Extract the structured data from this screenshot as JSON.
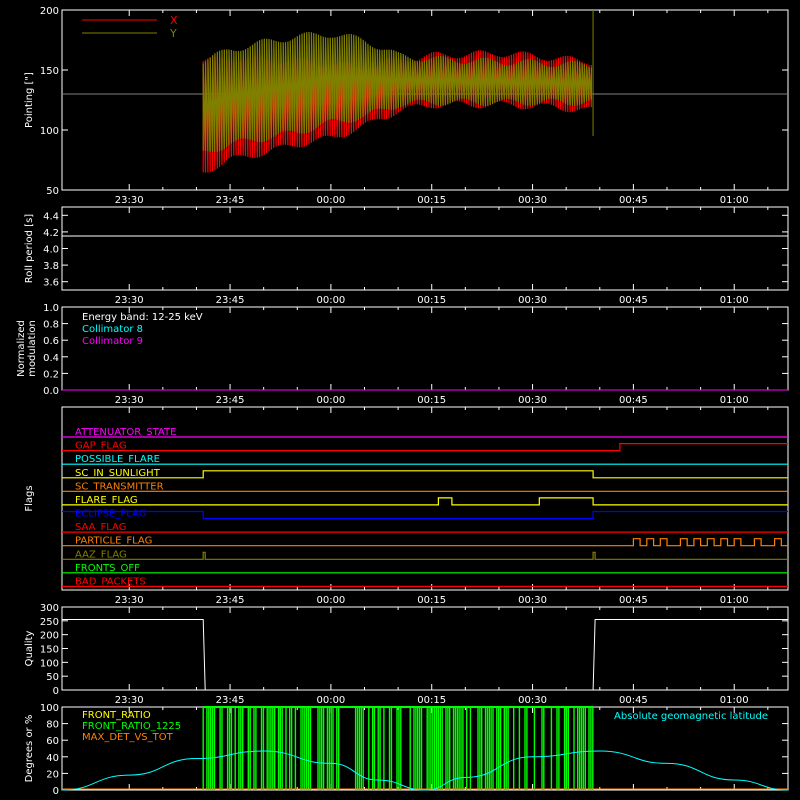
{
  "x_ticks": [
    "23:30",
    "23:45",
    "00:00",
    "00:15",
    "00:30",
    "00:45",
    "01:00"
  ],
  "colors": {
    "background": "#000000",
    "foreground": "#ffffff",
    "red": "#ff0000",
    "olive": "#808000",
    "cyan": "#00ffff",
    "magenta": "#ff00ff",
    "yellow": "#ffff00",
    "green": "#00ff00",
    "blue": "#0000ff",
    "orange": "#ff8000"
  },
  "chart_data": [
    {
      "type": "line",
      "id": "pointing",
      "ylabel": "Pointing [\"]",
      "ylim": [
        50,
        200
      ],
      "yticks": [
        50,
        100,
        150,
        200
      ],
      "legend": [
        {
          "name": "X",
          "color": "#ff0000"
        },
        {
          "name": "Y",
          "color": "#808000"
        }
      ],
      "legend_position": "top-left",
      "reference_line": 130,
      "series": [
        {
          "name": "X",
          "t": [
            "23:41",
            "23:45",
            "23:50",
            "23:55",
            "00:00",
            "00:05",
            "00:10",
            "00:15",
            "00:20",
            "00:25",
            "00:30",
            "00:35",
            "00:39"
          ],
          "low": [
            62,
            72,
            78,
            85,
            90,
            100,
            113,
            118,
            118,
            118,
            117,
            115,
            113
          ],
          "high": [
            160,
            163,
            162,
            160,
            158,
            155,
            161,
            165,
            166,
            167,
            165,
            162,
            160
          ]
        },
        {
          "name": "Y",
          "t": [
            "23:41",
            "23:45",
            "23:50",
            "23:55",
            "00:00",
            "00:05",
            "00:10",
            "00:15",
            "00:20",
            "00:25",
            "00:30",
            "00:35",
            "00:39"
          ],
          "low": [
            78,
            85,
            90,
            95,
            103,
            108,
            118,
            120,
            120,
            120,
            120,
            120,
            120
          ],
          "high": [
            160,
            170,
            176,
            181,
            183,
            178,
            165,
            162,
            161,
            160,
            159,
            158,
            157
          ]
        }
      ]
    },
    {
      "type": "line",
      "id": "roll",
      "ylabel": "Roll period [s]",
      "ylim": [
        3.5,
        4.5
      ],
      "yticks": [
        3.6,
        3.8,
        4.0,
        4.2,
        4.4
      ],
      "series": [
        {
          "name": "",
          "t": [
            "23:20",
            "01:08"
          ],
          "y": [
            4.15,
            4.15
          ]
        }
      ]
    },
    {
      "type": "line",
      "id": "modulation",
      "ylabel": "Normalized modulation",
      "ylim": [
        0,
        1
      ],
      "yticks": [
        0.0,
        0.2,
        0.4,
        0.6,
        0.8,
        1.0
      ],
      "annotation": "Energy band: 12-25 keV",
      "legend": [
        {
          "name": "Collimator 8",
          "color": "#00ffff"
        },
        {
          "name": "Collimator 9",
          "color": "#ff00ff"
        }
      ],
      "series": [
        {
          "name": "Collimator 9",
          "t": [
            "23:20",
            "01:08"
          ],
          "y": [
            0,
            0
          ]
        }
      ]
    },
    {
      "type": "line",
      "id": "flags",
      "ylabel": "Flags",
      "series": [
        {
          "name": "ATTENUATOR_STATE",
          "color": "#ff00ff",
          "steps": [
            [
              "23:20",
              0
            ],
            [
              "01:08",
              0
            ]
          ]
        },
        {
          "name": "GAP_FLAG",
          "color": "#ff0000",
          "steps": [
            [
              "23:20",
              0
            ],
            [
              "00:43",
              1
            ],
            [
              "01:08",
              1
            ]
          ]
        },
        {
          "name": "POSSIBLE_FLARE",
          "color": "#00ffff",
          "steps": [
            [
              "23:20",
              0
            ],
            [
              "01:08",
              0
            ]
          ]
        },
        {
          "name": "SC_IN_SUNLIGHT",
          "color": "#ffff00",
          "steps": [
            [
              "23:20",
              0
            ],
            [
              "23:41",
              1
            ],
            [
              "00:39",
              0
            ],
            [
              "01:08",
              0
            ]
          ]
        },
        {
          "name": "SC_TRANSMITTER",
          "color": "#ff8000",
          "steps": [
            [
              "23:20",
              0
            ],
            [
              "01:08",
              0
            ]
          ]
        },
        {
          "name": "FLARE_FLAG",
          "color": "#ffff00",
          "steps": [
            [
              "23:20",
              0
            ],
            [
              "00:16",
              1
            ],
            [
              "00:18",
              0
            ],
            [
              "00:31",
              1
            ],
            [
              "00:39",
              0
            ],
            [
              "01:08",
              0
            ]
          ]
        },
        {
          "name": "ECLIPSE_FLAG",
          "color": "#0000ff",
          "steps": [
            [
              "23:20",
              1
            ],
            [
              "23:41",
              0
            ],
            [
              "00:39",
              1
            ],
            [
              "01:08",
              1
            ]
          ]
        },
        {
          "name": "SAA_FLAG",
          "color": "#ff0000",
          "steps": [
            [
              "23:20",
              0
            ],
            [
              "01:08",
              0
            ]
          ]
        },
        {
          "name": "PARTICLE_FLAG",
          "color": "#ff8000",
          "steps": [
            [
              "23:20",
              0
            ],
            [
              "00:45",
              1
            ],
            [
              "00:46",
              0
            ],
            [
              "00:47",
              1
            ],
            [
              "00:48",
              0
            ],
            [
              "00:49",
              1
            ],
            [
              "00:50",
              0
            ],
            [
              "00:52",
              1
            ],
            [
              "00:53",
              0
            ],
            [
              "00:54",
              1
            ],
            [
              "00:55",
              0
            ],
            [
              "00:56",
              1
            ],
            [
              "00:57",
              0
            ],
            [
              "00:58",
              1
            ],
            [
              "00:59",
              0
            ],
            [
              "01:00",
              1
            ],
            [
              "01:01",
              0
            ],
            [
              "01:03",
              1
            ],
            [
              "01:04",
              0
            ],
            [
              "01:06",
              1
            ],
            [
              "01:07",
              0
            ],
            [
              "01:08",
              0
            ]
          ]
        },
        {
          "name": "AAZ_FLAG",
          "color": "#808000",
          "steps": [
            [
              "23:20",
              0
            ],
            [
              "23:41",
              1
            ],
            [
              "23:41.3",
              0
            ],
            [
              "00:39",
              1
            ],
            [
              "00:39.3",
              0
            ],
            [
              "01:08",
              0
            ]
          ]
        },
        {
          "name": "FRONTS_OFF",
          "color": "#00ff00",
          "steps": [
            [
              "23:20",
              0
            ],
            [
              "01:08",
              0
            ]
          ]
        },
        {
          "name": "BAD_PACKETS",
          "color": "#ff0000",
          "steps": [
            [
              "23:20",
              0
            ],
            [
              "01:08",
              0
            ]
          ]
        }
      ]
    },
    {
      "type": "line",
      "id": "quality",
      "ylabel": "Quality",
      "ylim": [
        0,
        300
      ],
      "yticks": [
        0,
        50,
        100,
        150,
        200,
        250,
        300
      ],
      "series": [
        {
          "name": "",
          "t": [
            "23:20",
            "23:41",
            "23:41.3",
            "00:39",
            "00:39.3",
            "01:08"
          ],
          "y": [
            255,
            255,
            0,
            0,
            255,
            255
          ]
        }
      ]
    },
    {
      "type": "line",
      "id": "bottom",
      "ylabel": "Degrees or %",
      "ylim": [
        0,
        100
      ],
      "yticks": [
        0,
        20,
        40,
        60,
        80,
        100
      ],
      "legend": [
        {
          "name": "FRONT_RATIO",
          "color": "#ffff00"
        },
        {
          "name": "FRONT_RATIO_1225",
          "color": "#00ff00"
        },
        {
          "name": "MAX_DET_VS_TOT",
          "color": "#ff8000"
        },
        {
          "name": "Absolute geomagnetic latitude",
          "color": "#00ffff"
        }
      ],
      "series": [
        {
          "name": "Absolute geomagnetic latitude",
          "t": [
            "23:20",
            "23:30",
            "23:40",
            "23:50",
            "00:00",
            "00:07",
            "00:14",
            "00:20",
            "00:30",
            "00:40",
            "00:50",
            "01:00",
            "01:08"
          ],
          "y": [
            0,
            18,
            38,
            47,
            32,
            12,
            0,
            15,
            40,
            47,
            32,
            12,
            0
          ]
        },
        {
          "name": "FRONT_RATIO_1225",
          "range": [
            "23:41",
            "00:39"
          ],
          "y": 100
        },
        {
          "name": "MAX_DET_VS_TOT",
          "t": [
            "23:20",
            "01:08"
          ],
          "y": [
            0,
            0
          ]
        }
      ]
    }
  ]
}
